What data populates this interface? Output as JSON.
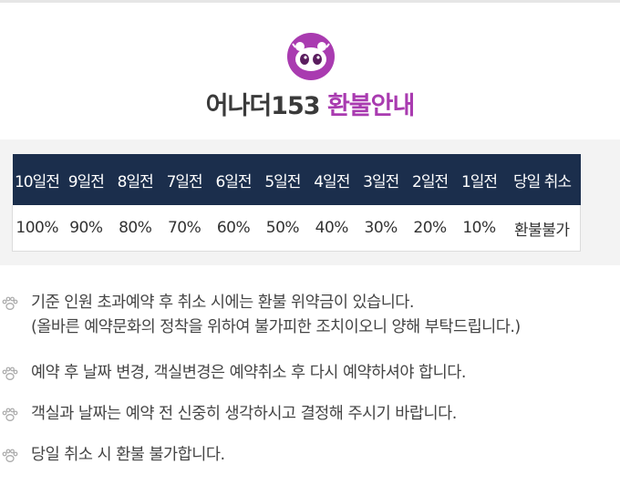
{
  "header": {
    "brand": "어나더153",
    "title": "환불안내",
    "logo_icon": "panda-face-icon"
  },
  "refund_table": {
    "headers": [
      "10일전",
      "9일전",
      "8일전",
      "7일전",
      "6일전",
      "5일전",
      "4일전",
      "3일전",
      "2일전",
      "1일전",
      "당일 취소"
    ],
    "values": [
      "100%",
      "90%",
      "80%",
      "70%",
      "60%",
      "50%",
      "40%",
      "30%",
      "20%",
      "10%",
      "환불불가"
    ]
  },
  "notes": [
    {
      "lines": [
        "기준 인원 초과예약 후 취소 시에는 환불 위약금이 있습니다.",
        "(올바른 예약문화의 정착을 위하여 불가피한 조치이오니 양해 부탁드립니다.)"
      ]
    },
    {
      "lines": [
        "예약 후 날짜 변경, 객실변경은 예약취소 후 다시 예약하셔야 합니다."
      ]
    },
    {
      "lines": [
        "객실과 날짜는 예약 전 신중히 생각하시고 결정해 주시기 바랍니다."
      ]
    },
    {
      "lines": [
        "당일 취소 시 환불 불가합니다."
      ]
    }
  ],
  "colors": {
    "accent": "#a93bb0",
    "table_header_bg": "#1b2e4c",
    "zone_bg": "#f3f3f3"
  }
}
